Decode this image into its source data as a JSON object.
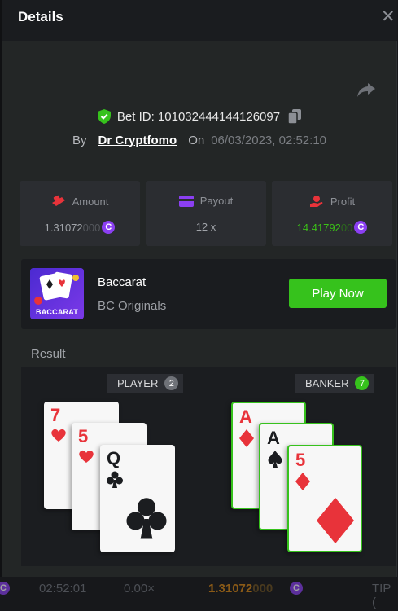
{
  "modal": {
    "title": "Details",
    "close_icon": "close-icon",
    "share_icon": "share-icon"
  },
  "bet": {
    "id_text": "Bet ID: 101032444144126097",
    "by_label": "By",
    "user": "Dr Cryptfomo",
    "on_label": "On",
    "date": "06/03/2023, 02:52:10"
  },
  "stats": {
    "amount": {
      "label": "Amount",
      "value_main": "1.31072",
      "value_dim": "000",
      "coin": "C"
    },
    "payout": {
      "label": "Payout",
      "value": "12 x"
    },
    "profit": {
      "label": "Profit",
      "value_main": "14.41792",
      "value_dim": "00",
      "coin": "C"
    }
  },
  "game": {
    "thumb_label": "BACCARAT",
    "name": "Baccarat",
    "provider": "BC Originals",
    "play_label": "Play Now"
  },
  "result": {
    "label": "Result",
    "player": {
      "label": "PLAYER",
      "score": "2",
      "cards": [
        {
          "rank": "7",
          "suit": "hearts"
        },
        {
          "rank": "5",
          "suit": "hearts"
        },
        {
          "rank": "Q",
          "suit": "clubs"
        }
      ]
    },
    "banker": {
      "label": "BANKER",
      "score": "7",
      "cards": [
        {
          "rank": "A",
          "suit": "diamonds"
        },
        {
          "rank": "A",
          "suit": "spades"
        },
        {
          "rank": "5",
          "suit": "diamonds"
        }
      ]
    }
  },
  "bottom_bar": {
    "time": "02:52:01",
    "multiplier": "0.00×",
    "amount_main": "1.31072",
    "amount_dim": "000",
    "coin": "C",
    "tip": "TIP ("
  },
  "colors": {
    "accent_green": "#36c21c",
    "profit_green": "#3bc117",
    "coin_purple": "#8b3ff2",
    "suit_red": "#e8333a"
  }
}
